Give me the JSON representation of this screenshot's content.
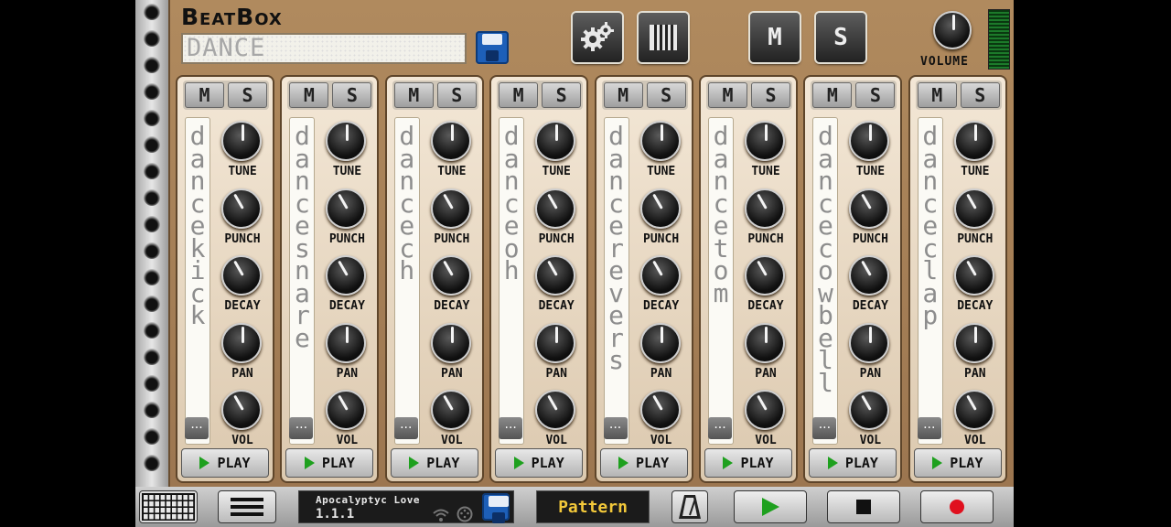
{
  "device": {
    "title": "BeatBox",
    "kit_name": "DANCE",
    "volume_label": "VOLUME"
  },
  "header_buttons": {
    "settings": "settings-gear-icon",
    "keyboard": "piano-icon",
    "mute": "M",
    "solo": "S"
  },
  "channel_buttons": {
    "mute": "M",
    "solo": "S",
    "more": "...",
    "play": "PLAY"
  },
  "knob_labels": {
    "tune": "TUNE",
    "punch": "PUNCH",
    "decay": "DECAY",
    "pan": "PAN",
    "vol": "VOL"
  },
  "channels": [
    {
      "sample": "dancekick"
    },
    {
      "sample": "dancesnare"
    },
    {
      "sample": "dancech"
    },
    {
      "sample": "danceoh"
    },
    {
      "sample": "dancerevers"
    },
    {
      "sample": "dancetom"
    },
    {
      "sample": "dancecowbell"
    },
    {
      "sample": "danceclap"
    }
  ],
  "bottom_bar": {
    "song_title": "Apocalyptyc Love",
    "position": "1.1.1",
    "pattern_label": "Pattern"
  },
  "colors": {
    "rack": "#a57f56",
    "play_green": "#1ea01e",
    "record_red": "#e0101e",
    "pattern_text": "#f2c83a",
    "floppy_blue": "#1d5fb8"
  }
}
